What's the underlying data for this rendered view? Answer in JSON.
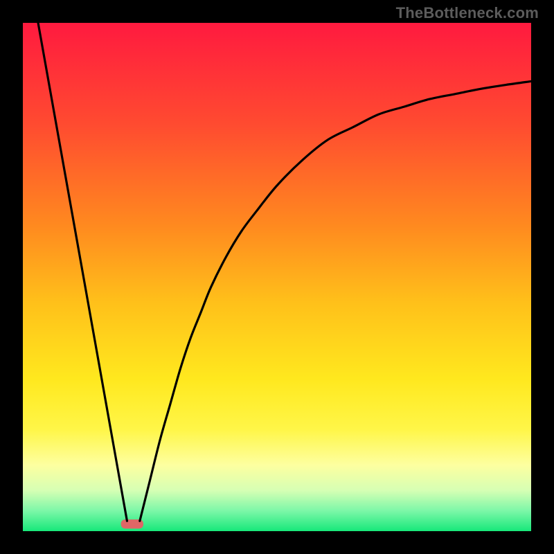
{
  "watermark": "TheBottleneck.com",
  "chart_data": {
    "type": "line",
    "title": "",
    "xlabel": "",
    "ylabel": "",
    "xlim": [
      0,
      100
    ],
    "ylim": [
      0,
      100
    ],
    "grid": false,
    "legend": false,
    "background_gradient": {
      "stops": [
        {
          "offset": 0.0,
          "color": "#ff1a3f"
        },
        {
          "offset": 0.2,
          "color": "#ff4b30"
        },
        {
          "offset": 0.4,
          "color": "#ff8a1f"
        },
        {
          "offset": 0.55,
          "color": "#ffc01a"
        },
        {
          "offset": 0.7,
          "color": "#ffe81e"
        },
        {
          "offset": 0.8,
          "color": "#fff648"
        },
        {
          "offset": 0.87,
          "color": "#fdffa0"
        },
        {
          "offset": 0.92,
          "color": "#d6ffb4"
        },
        {
          "offset": 0.96,
          "color": "#7cf7a8"
        },
        {
          "offset": 1.0,
          "color": "#17e87a"
        }
      ]
    },
    "series": [
      {
        "name": "left-line",
        "x": [
          3,
          20.5
        ],
        "y": [
          100,
          2
        ]
      },
      {
        "name": "right-curve",
        "x": [
          23,
          25,
          27,
          29,
          31,
          33,
          35,
          37,
          40,
          43,
          46,
          50,
          55,
          60,
          65,
          70,
          75,
          80,
          85,
          90,
          95,
          100
        ],
        "y": [
          2,
          10,
          18,
          25,
          32,
          38,
          43,
          48,
          54,
          59,
          63,
          68,
          73,
          77,
          79.5,
          82,
          83.5,
          85,
          86,
          87,
          87.8,
          88.5
        ]
      }
    ],
    "marker": {
      "name": "bottom-marker",
      "x": 21.5,
      "y": 1.4,
      "width": 4.4,
      "height": 1.8,
      "color": "#e06666"
    }
  }
}
